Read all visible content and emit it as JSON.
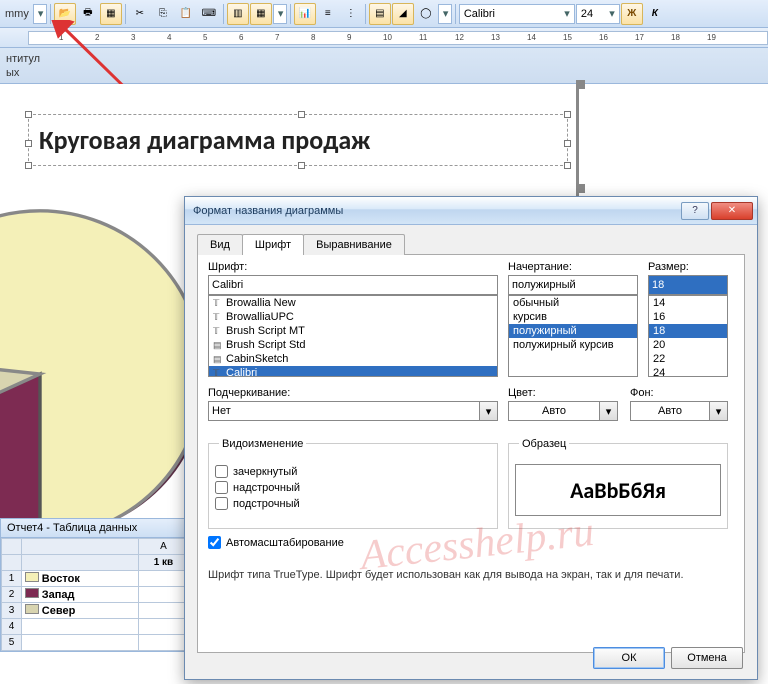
{
  "toolbar": {
    "menu_label": "mmy",
    "font_name": "Calibri",
    "font_size": "24",
    "bold": "Ж",
    "italic": "К"
  },
  "nav": {
    "line1": "нтитул",
    "line2": "ых"
  },
  "chart_title": "Круговая диаграмма продаж",
  "chart_data": {
    "type": "pie",
    "title": "Круговая диаграмма продаж",
    "series": [
      {
        "name": "Восток",
        "color": "#f4f0b8"
      },
      {
        "name": "Запад",
        "color": "#7d2b52"
      },
      {
        "name": "Север",
        "color": "#d8d4b0"
      }
    ]
  },
  "datasheet": {
    "title": "Отчет4 - Таблица данных",
    "col_a": "A",
    "col_header": "1 кв",
    "rows": [
      {
        "n": "1",
        "label": "Восток"
      },
      {
        "n": "2",
        "label": "Запад"
      },
      {
        "n": "3",
        "label": "Север"
      },
      {
        "n": "4",
        "label": ""
      },
      {
        "n": "5",
        "label": ""
      }
    ]
  },
  "dialog": {
    "title": "Формат названия диаграммы",
    "help": "?",
    "close": "✕",
    "tabs": {
      "view": "Вид",
      "font": "Шрифт",
      "align": "Выравнивание"
    },
    "font_label": "Шрифт:",
    "font_value": "Calibri",
    "font_list": [
      "Browallia New",
      "BrowalliaUPC",
      "Brush Script MT",
      "Brush Script Std",
      "CabinSketch",
      "Calibri"
    ],
    "style_label": "Начертание:",
    "style_value": "полужирный",
    "style_list": [
      "обычный",
      "курсив",
      "полужирный",
      "полужирный курсив"
    ],
    "size_label": "Размер:",
    "size_value": "18",
    "size_list": [
      "14",
      "16",
      "18",
      "20",
      "22",
      "24"
    ],
    "underline_label": "Подчеркивание:",
    "underline_value": "Нет",
    "color_label": "Цвет:",
    "color_value": "Авто",
    "bg_label": "Фон:",
    "bg_value": "Авто",
    "effects_label": "Видоизменение",
    "effects": {
      "strike": "зачеркнутый",
      "super": "надстрочный",
      "sub": "подстрочный"
    },
    "preview_label": "Образец",
    "preview_text": "АаВbБбЯя",
    "autoscale": "Автомасштабирование",
    "note": "Шрифт типа TrueType. Шрифт будет использован как для вывода на экран, так и для печати.",
    "ok": "ОК",
    "cancel": "Отмена"
  },
  "watermark": "Accesshelp.ru"
}
